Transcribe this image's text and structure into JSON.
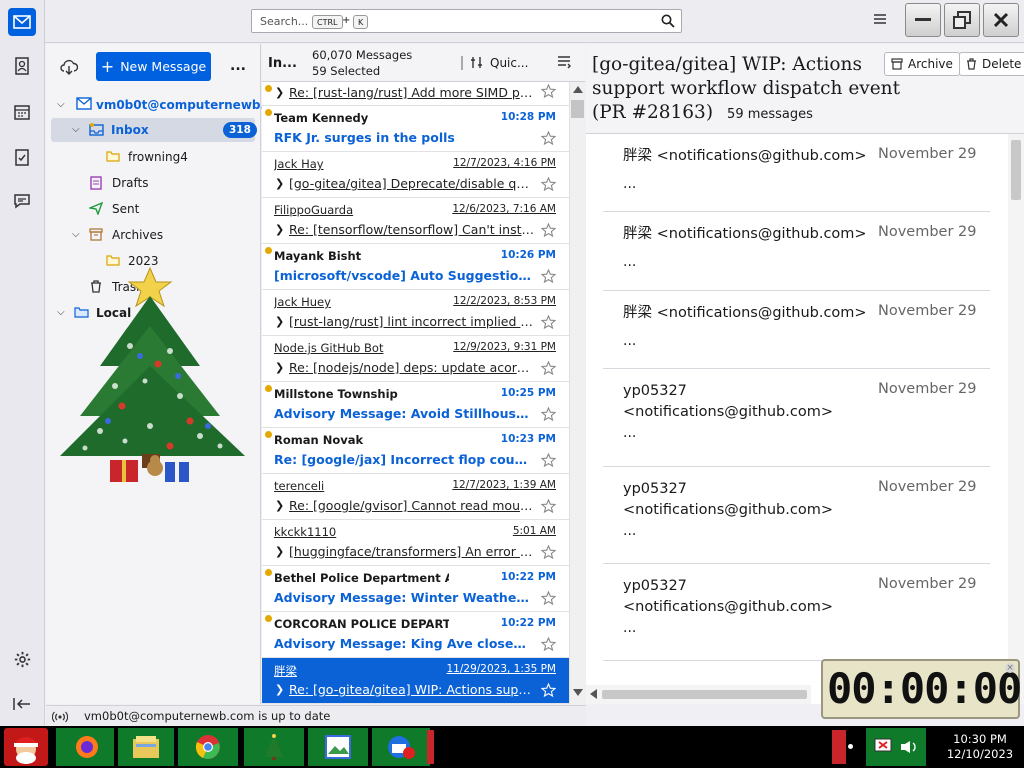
{
  "search": {
    "placeholder": "Search...",
    "kbd1": "CTRL",
    "plus": "+",
    "kbd2": "K"
  },
  "folders": {
    "new_message": "New Message",
    "more": "...",
    "account": "vm0b0t@computernewb...",
    "inbox": "Inbox",
    "inbox_count": "318",
    "frowning4": "frowning4",
    "drafts": "Drafts",
    "sent": "Sent",
    "archives": "Archives",
    "year_2023": "2023",
    "trash": "Trash",
    "local": "Local"
  },
  "list": {
    "folder_short": "In...",
    "messages": "60,070 Messages",
    "selected": "59 Selected",
    "quick": "Quic..."
  },
  "messages": [
    {
      "from": "",
      "date": "",
      "subject": "Re: [rust-lang/rust] Add more SIMD plat...",
      "state": "partial"
    },
    {
      "from": "Team Kennedy",
      "date": "10:28 PM",
      "subject": "RFK Jr. surges in the polls",
      "state": "unread"
    },
    {
      "from": "Jack Hay",
      "date": "12/7/2023, 4:16 PM",
      "subject": "[go-gitea/gitea] Deprecate/disable quer...",
      "state": "read"
    },
    {
      "from": "FilippoGuarda",
      "date": "12/6/2023, 7:16 AM",
      "subject": "Re: [tensorflow/tensorflow] Can't install t...",
      "state": "read"
    },
    {
      "from": "Mayank Bisht",
      "date": "10:26 PM",
      "subject": "[microsoft/vscode] Auto Suggestion Fre...",
      "state": "unread"
    },
    {
      "from": "Jack Huey",
      "date": "12/2/2023, 8:53 PM",
      "subject": "[rust-lang/rust] lint incorrect implied bo...",
      "state": "read"
    },
    {
      "from": "Node.js GitHub Bot",
      "date": "12/9/2023, 9:31 PM",
      "subject": "Re: [nodejs/node] deps: update acorn-...",
      "state": "read"
    },
    {
      "from": "Millstone Township",
      "date": "10:25 PM",
      "subject": "Advisory Message: Avoid Stillhouse goi...",
      "state": "unread"
    },
    {
      "from": "Roman Novak",
      "date": "10:23 PM",
      "subject": "Re: [google/jax] Incorrect flop count es...",
      "state": "unread"
    },
    {
      "from": "terenceli",
      "date": "12/7/2023, 1:39 AM",
      "subject": "Re: [google/gvisor] Cannot read mount...",
      "state": "read"
    },
    {
      "from": "kkckk1110",
      "date": "5:01 AM",
      "subject": "[huggingface/transformers] An error wh...",
      "state": "read"
    },
    {
      "from": "Bethel Police Department AK",
      "date": "10:22 PM",
      "subject": "Advisory Message: Winter Weather Adv...",
      "state": "unread"
    },
    {
      "from": "CORCORAN POLICE DEPARTMENT",
      "date": "10:22 PM",
      "subject": "Advisory Message: King Ave closed bet...",
      "state": "unread"
    },
    {
      "from": "胖梁",
      "date": "11/29/2023, 1:35 PM",
      "subject": "Re: [go-gitea/gitea] WIP: Actions suppor...",
      "state": "selected"
    }
  ],
  "reader": {
    "title": "[go-gitea/gitea] WIP: Actions support workflow dispatch event (PR #28163)",
    "title_l1": "[go-gitea/gitea] WIP: Actions",
    "title_l2": "support workflow dispatch event",
    "title_l3": "(PR #28163)",
    "count": "59 messages",
    "archive": "Archive",
    "delete": "Delete",
    "cards": [
      {
        "s1": "胖梁 <notifications@github.com>",
        "s2": "",
        "date": "November 29",
        "dots": "..."
      },
      {
        "s1": "胖梁 <notifications@github.com>",
        "s2": "",
        "date": "November 29",
        "dots": "..."
      },
      {
        "s1": "胖梁 <notifications@github.com>",
        "s2": "",
        "date": "November 29",
        "dots": "..."
      },
      {
        "s1": "yp05327",
        "s2": "<notifications@github.com>",
        "date": "November 29",
        "dots": "..."
      },
      {
        "s1": "yp05327",
        "s2": "<notifications@github.com>",
        "date": "November 29",
        "dots": "..."
      },
      {
        "s1": "yp05327",
        "s2": "<notifications@github.com>",
        "date": "November 29",
        "dots": "..."
      }
    ]
  },
  "status": {
    "text": "vm0b0t@computernewb.com is up to date"
  },
  "clock_widget": {
    "digits": "00:00:00"
  },
  "taskbar": {
    "time": "10:30 PM",
    "date": "12/10/2023"
  },
  "colors": {
    "accent": "#0061e0",
    "selected": "#0b62d6",
    "unread_dot": "#e5a800",
    "taskbar_green": "#0f7a2a"
  }
}
